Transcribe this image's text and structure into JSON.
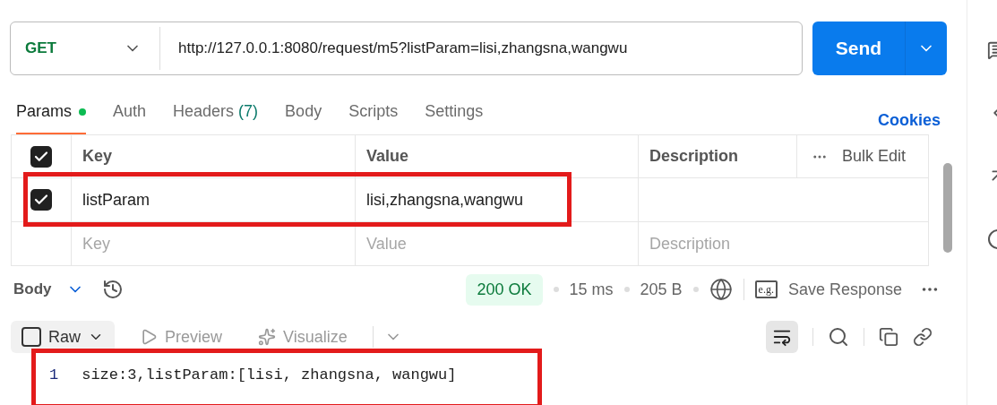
{
  "request": {
    "method": "GET",
    "url": "http://127.0.0.1:8080/request/m5?listParam=lisi,zhangsna,wangwu",
    "send_label": "Send"
  },
  "tabs": [
    {
      "label": "Params",
      "selected": true,
      "has_dot": true
    },
    {
      "label": "Auth",
      "selected": false,
      "has_dot": false
    },
    {
      "label": "Headers",
      "count": "(7)",
      "selected": false,
      "has_dot": false
    },
    {
      "label": "Body",
      "selected": false,
      "has_dot": false
    },
    {
      "label": "Scripts",
      "selected": false,
      "has_dot": false
    },
    {
      "label": "Settings",
      "selected": false,
      "has_dot": false
    }
  ],
  "cookies_link": "Cookies",
  "params_table": {
    "header_checked": true,
    "columns": [
      "Key",
      "Value",
      "Description"
    ],
    "bulk_edit": "Bulk Edit",
    "rows": [
      {
        "checked": true,
        "key": "listParam",
        "value": "lisi,zhangsna,wangwu",
        "highlighted": true
      }
    ],
    "placeholder_row": {
      "key": "Key",
      "value": "Value",
      "description": "Description"
    }
  },
  "response": {
    "body_label": "Body",
    "status": "200 OK",
    "time": "15 ms",
    "size": "205 B",
    "example_label": "e.g.",
    "save_label": "Save Response",
    "view_tabs": [
      {
        "label": "Raw",
        "selected": true
      },
      {
        "label": "Preview",
        "selected": false
      },
      {
        "label": "Visualize",
        "selected": false
      }
    ],
    "wrap_on": true,
    "lines": [
      {
        "number": "1",
        "text": "size:3,listParam:[lisi, zhangsna, wangwu]"
      }
    ],
    "highlighted": true
  }
}
